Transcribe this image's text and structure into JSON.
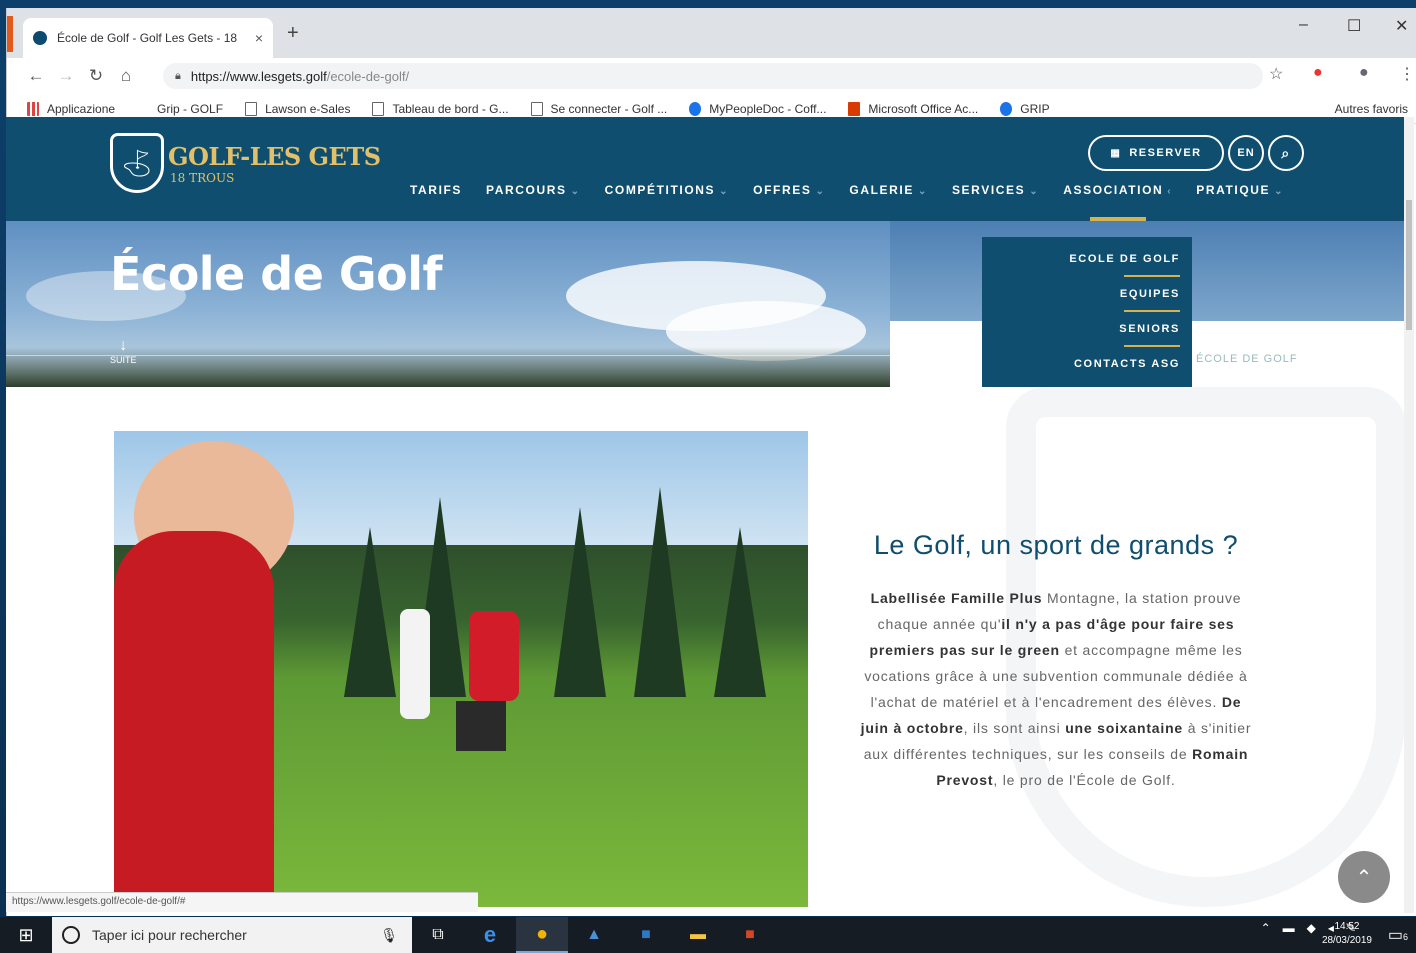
{
  "browser": {
    "tab_title": "École de Golf - Golf Les Gets - 18",
    "tab_close": "×",
    "new_tab": "+",
    "url_main": "https://www.lesgets.golf",
    "url_path": "/ecole-de-golf/",
    "window_controls": [
      "–",
      "☐",
      "✕"
    ]
  },
  "bookmarks": {
    "items": [
      "Applicazione",
      "Grip - GOLF",
      "Lawson e-Sales",
      "Tableau de bord - G...",
      "Se connecter - Golf ...",
      "MyPeopleDoc - Coff...",
      "Microsoft Office Ac...",
      "GRIP"
    ],
    "other": "Autres favoris"
  },
  "site": {
    "logo_name": "GOLF-LES GETS",
    "logo_sub": "18 TROUS",
    "reserve_label": "RESERVER",
    "lang_label": "EN",
    "nav": [
      "TARIFS",
      "PARCOURS",
      "COMPÉTITIONS",
      "OFFRES",
      "GALERIE",
      "SERVICES",
      "ASSOCIATION",
      "PRATIQUE"
    ],
    "submenu": [
      "ECOLE DE GOLF",
      "EQUIPES",
      "SENIORS",
      "CONTACTS ASG"
    ],
    "hero_title": "École de Golf",
    "hero_suite": "SUITE",
    "breadcrumb": "ÉCOLE DE GOLF"
  },
  "content": {
    "heading": "Le Golf, un sport de grands ?",
    "p_parts": {
      "a": "Labellisée Famille Plus",
      "b": " Montagne, la station prouve chaque année qu'",
      "c": "il n'y a pas d'âge pour faire ses premiers pas sur le green",
      "d": " et accompagne même les vocations grâce à une subvention communale dédiée à l'achat de matériel et à l'encadrement des élèves. ",
      "e": "De juin à octobre",
      "f": ", ils sont ainsi ",
      "g": "une soixantaine",
      "h": " à s'initier aux différentes techniques, sur les conseils de ",
      "i": "Romain Prevost",
      "j": ", le pro de l'École de Golf."
    }
  },
  "status_url": "https://www.lesgets.golf/ecole-de-golf/#",
  "taskbar": {
    "search_placeholder": "Taper ici pour rechercher",
    "time": "14:52",
    "date": "28/03/2019",
    "notif_count": "6"
  },
  "colors": {
    "brand": "#0f4e6e",
    "gold": "#d6b24e"
  }
}
